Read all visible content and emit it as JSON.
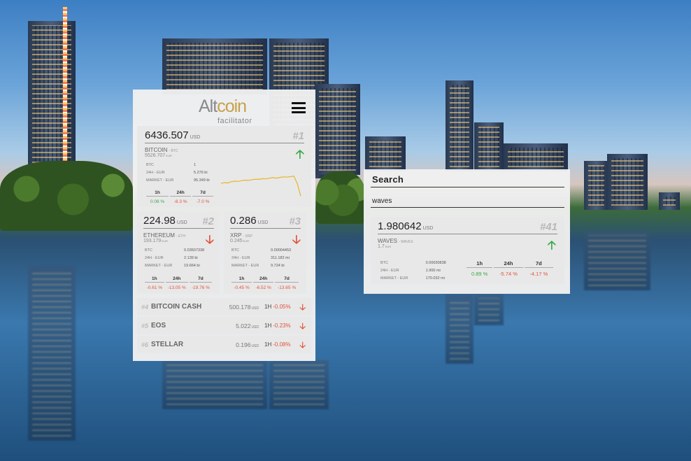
{
  "logo": {
    "part1": "Alt",
    "part2": "coin",
    "subtitle": "facilitator"
  },
  "top_coin": {
    "price": "6436.507",
    "unit": "USD",
    "rank": "#1",
    "name": "BITCOIN",
    "symbol": "- BTC",
    "eur_price": "5526.707",
    "eur_unit": "EUR",
    "stats": [
      {
        "k": "BTC",
        "v": "1"
      },
      {
        "k": "24H - EUR",
        "v": "5.276 bi"
      },
      {
        "k": "MARKET - EUR",
        "v": "95.349 bi"
      }
    ],
    "perf_labels": [
      "1h",
      "24h",
      "7d"
    ],
    "perf_values": [
      "0.06 %",
      "-8.3 %",
      "-7.0 %"
    ],
    "trend": "up",
    "sparkline": [
      0.55,
      0.58,
      0.57,
      0.62,
      0.64,
      0.63,
      0.66,
      0.68,
      0.67,
      0.7,
      0.72,
      0.71,
      0.74,
      0.73,
      0.76,
      0.78,
      0.76,
      0.79,
      0.81,
      0.8,
      0.82,
      0.84,
      0.55,
      0.05
    ]
  },
  "mid_coins": [
    {
      "price": "224.98",
      "unit": "USD",
      "rank": "#2",
      "name": "ETHEREUM",
      "symbol": "- ETH",
      "eur_price": "193.179",
      "eur_unit": "EUR",
      "stats": [
        {
          "k": "BTC",
          "v": "0.03507338"
        },
        {
          "k": "24H - EUR",
          "v": "2.139 bi"
        },
        {
          "k": "MARKET - EUR",
          "v": "19.664 bi"
        }
      ],
      "perf_labels": [
        "1h",
        "24h",
        "7d"
      ],
      "perf_values": [
        "-0.61 %",
        "-13.05 %",
        "-19.76 %"
      ],
      "trend": "down"
    },
    {
      "price": "0.286",
      "unit": "USD",
      "rank": "#3",
      "name": "XRP",
      "symbol": "- XRP",
      "eur_price": "0.245",
      "eur_unit": "EUR",
      "stats": [
        {
          "k": "BTC",
          "v": "0.00004453"
        },
        {
          "k": "24H - EUR",
          "v": "311.182 mi"
        },
        {
          "k": "MARKET - EUR",
          "v": "9.724 bi"
        }
      ],
      "perf_labels": [
        "1h",
        "24h",
        "7d"
      ],
      "perf_values": [
        "-0.45 %",
        "-6.52 %",
        "-13.65 %"
      ],
      "trend": "down"
    }
  ],
  "list_coins": [
    {
      "rank": "#4",
      "name": "BITCOIN CASH",
      "price": "500.178",
      "unit": "USD",
      "label": "1H",
      "change": "-0.05%",
      "trend": "down"
    },
    {
      "rank": "#5",
      "name": "EOS",
      "price": "5.022",
      "unit": "USD",
      "label": "1H",
      "change": "-0.23%",
      "trend": "down"
    },
    {
      "rank": "#6",
      "name": "STELLAR",
      "price": "0.196",
      "unit": "USD",
      "label": "1H",
      "change": "-0.08%",
      "trend": "down"
    }
  ],
  "search": {
    "label": "Search",
    "query": "waves",
    "result": {
      "price": "1.980642",
      "unit": "USD",
      "rank": "#41",
      "name": "WAVES",
      "symbol": "- WAVES",
      "eur_price": "1.7",
      "eur_unit": "EUR",
      "stats": [
        {
          "k": "BTC",
          "v": "0.00030838"
        },
        {
          "k": "24H - EUR",
          "v": "1.900 mi"
        },
        {
          "k": "MARKET - EUR",
          "v": "170.032 mi"
        }
      ],
      "perf_labels": [
        "1h",
        "24h",
        "7d"
      ],
      "perf_values": [
        "0.89 %",
        "-5.74 %",
        "-4.17 %"
      ],
      "trend": "up"
    }
  },
  "colors": {
    "positive": "#3aa84a",
    "negative": "#e0553d",
    "logo_gold": "#c9a04a",
    "sparkline": "#e8b52a"
  }
}
